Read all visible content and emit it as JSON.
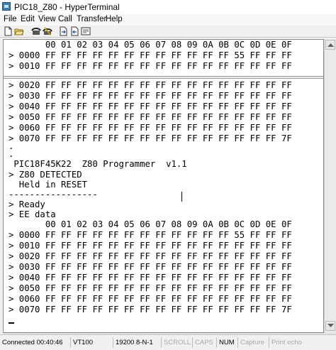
{
  "window": {
    "title": "PIC18_Z80 - HyperTerminal"
  },
  "menu": [
    "File",
    "Edit",
    "View",
    "Call",
    "Transfer",
    "Help"
  ],
  "toolbar": [
    "new-connection-icon",
    "open-icon",
    "phone-icon",
    "disconnect-icon",
    "send-file-icon",
    "receive-file-icon",
    "properties-icon"
  ],
  "terminal": {
    "upper_pane": [
      "       00 01 02 03 04 05 06 07 08 09 0A 0B 0C 0D 0E 0F",
      "> 0000 FF FF FF FF FF FF FF FF FF FF FF FF 55 FF FF FF",
      "> 0010 FF FF FF FF FF FF FF FF FF FF FF FF FF FF FF FF"
    ],
    "lower_pane": [
      "> 0020 FF FF FF FF FF FF FF FF FF FF FF FF FF FF FF FF",
      "> 0030 FF FF FF FF FF FF FF FF FF FF FF FF FF FF FF FF",
      "> 0040 FF FF FF FF FF FF FF FF FF FF FF FF FF FF FF FF",
      "> 0050 FF FF FF FF FF FF FF FF FF FF FF FF FF FF FF FF",
      "> 0060 FF FF FF FF FF FF FF FF FF FF FF FF FF FF FF FF",
      "> 0070 FF FF FF FF FF FF FF FF FF FF FF FF FF FF FF 7F",
      ".",
      ".",
      " PIC18F45K22  Z80 Programmer  v1.1",
      "> Z80 DETECTED",
      "  Held in RESET",
      "-----------------",
      "> Ready",
      "> EE data",
      "       00 01 02 03 04 05 06 07 08 09 0A 0B 0C 0D 0E 0F",
      "> 0000 FF FF FF FF FF FF FF FF FF FF FF FF 55 FF FF FF",
      "> 0010 FF FF FF FF FF FF FF FF FF FF FF FF FF FF FF FF",
      "> 0020 FF FF FF FF FF FF FF FF FF FF FF FF FF FF FF FF",
      "> 0030 FF FF FF FF FF FF FF FF FF FF FF FF FF FF FF FF",
      "> 0040 FF FF FF FF FF FF FF FF FF FF FF FF FF FF FF FF",
      "> 0050 FF FF FF FF FF FF FF FF FF FF FF FF FF FF FF FF",
      "> 0060 FF FF FF FF FF FF FF FF FF FF FF FF FF FF FF FF",
      "> 0070 FF FF FF FF FF FF FF FF FF FF FF FF FF FF FF 7F"
    ]
  },
  "status": {
    "connected": "Connected 00:40:46",
    "emulation": "VT100",
    "settings": "19200 8-N-1",
    "scroll": "SCROLL",
    "caps": "CAPS",
    "num": "NUM",
    "capture": "Capture",
    "print_echo": "Print echo"
  },
  "colors": {
    "accent": "#3c7fb8",
    "terminal_bg": "#ffffff",
    "disabled_text": "#a8a8a8"
  }
}
